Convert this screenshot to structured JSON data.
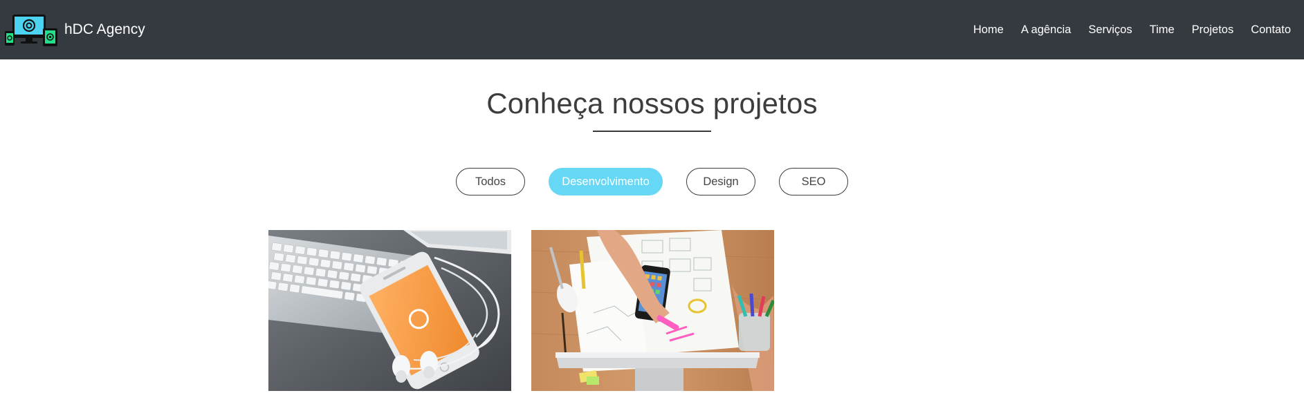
{
  "brand": {
    "name": "hDC Agency",
    "logo_icon": "devices-logo-icon"
  },
  "nav": {
    "items": [
      {
        "label": "Home"
      },
      {
        "label": "A agência"
      },
      {
        "label": "Serviços"
      },
      {
        "label": "Time"
      },
      {
        "label": "Projetos"
      },
      {
        "label": "Contato"
      }
    ]
  },
  "projects_section": {
    "title": "Conheça nossos projetos",
    "filters": [
      {
        "label": "Todos",
        "active": false
      },
      {
        "label": "Desenvolvimento",
        "active": true
      },
      {
        "label": "Design",
        "active": false
      },
      {
        "label": "SEO",
        "active": false
      }
    ],
    "items": [
      {
        "image": "keyboard-smartphone-earphones-photo"
      },
      {
        "image": "desk-sketching-smartphone-photo"
      }
    ]
  },
  "colors": {
    "navbar_bg": "#343a40",
    "accent": "#66d8f5",
    "text": "#3a3a3a",
    "logo_green": "#22e08a",
    "logo_cyan": "#4dd3f0"
  }
}
